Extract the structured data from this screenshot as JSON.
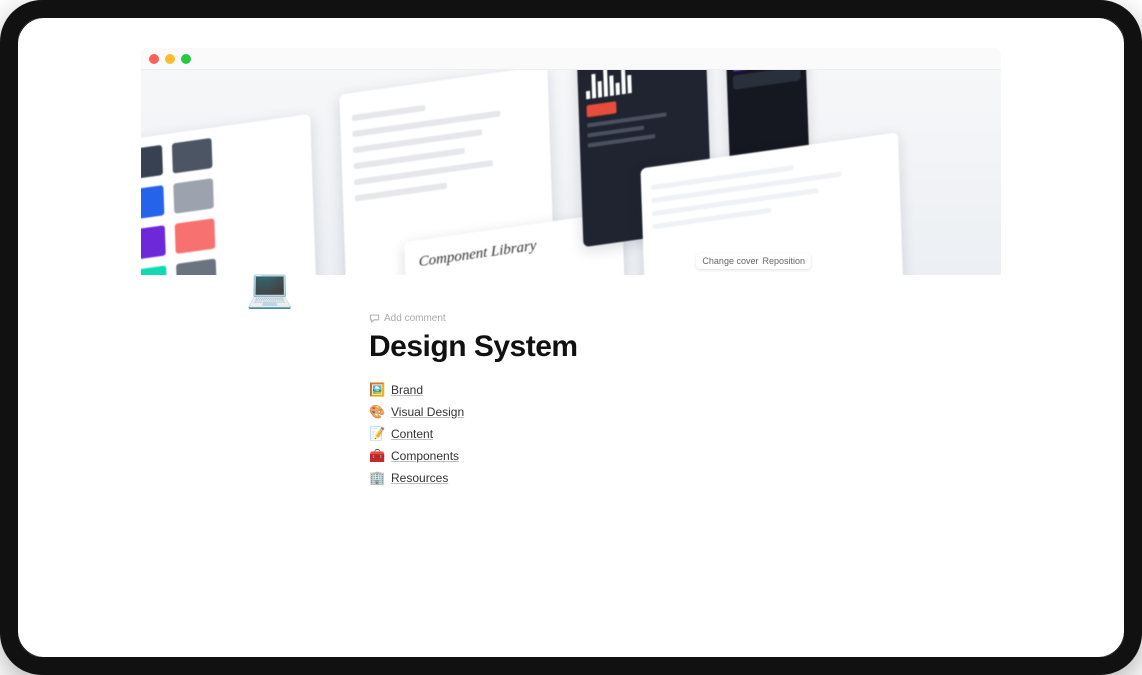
{
  "page": {
    "title": "Design System",
    "icon": "💻",
    "add_comment_label": "Add comment"
  },
  "cover": {
    "change_cover_label": "Change cover",
    "reposition_label": "Reposition",
    "mock_label": "Component Library",
    "swatches": {
      "blue": "#2563eb",
      "dark1": "#374151",
      "dark2": "#4b5563",
      "teal": "#10d9b4",
      "purple": "#6d28d9",
      "coral": "#f87171",
      "cyan": "#22d3ee",
      "violet": "#7c3aed"
    }
  },
  "links": [
    {
      "icon": "🖼️",
      "label": "Brand"
    },
    {
      "icon": "🎨",
      "label": "Visual Design"
    },
    {
      "icon": "📝",
      "label": "Content"
    },
    {
      "icon": "🧰",
      "label": "Components"
    },
    {
      "icon": "🏢",
      "label": "Resources"
    }
  ]
}
